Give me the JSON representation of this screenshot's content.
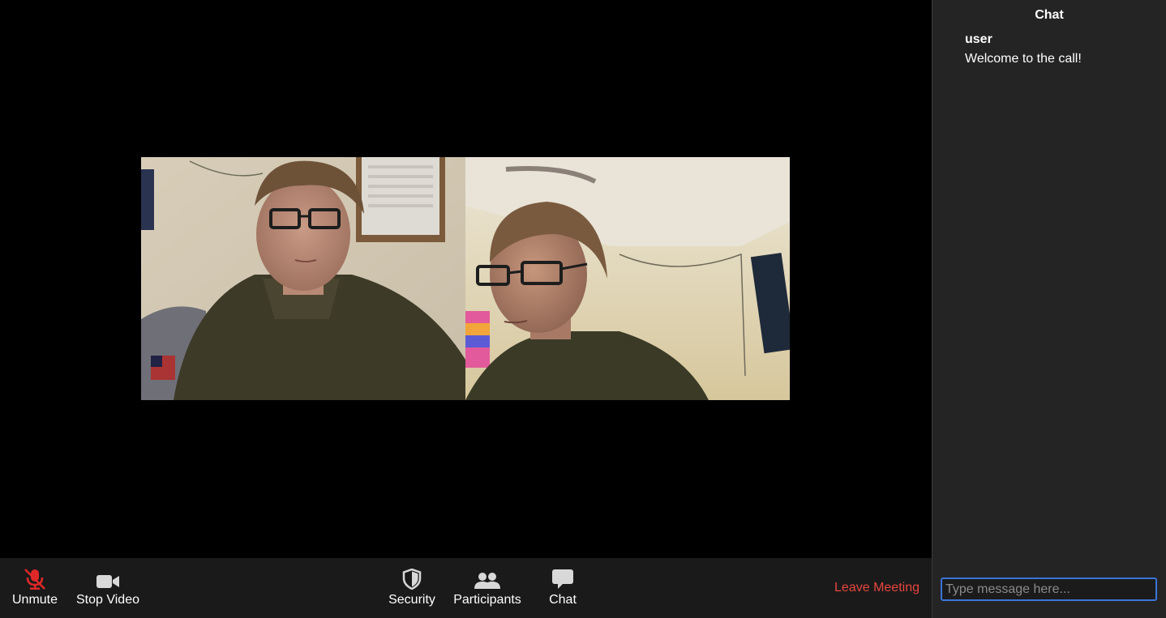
{
  "stage": {
    "tiles": [
      {
        "icon": "participant-video-1"
      },
      {
        "icon": "participant-video-2"
      }
    ]
  },
  "toolbar": {
    "unmute": {
      "label": "Unmute",
      "icon": "muted-mic-icon"
    },
    "stop_video": {
      "label": "Stop Video",
      "icon": "video-camera-icon"
    },
    "security": {
      "label": "Security",
      "icon": "shield-icon"
    },
    "participants": {
      "label": "Participants",
      "icon": "people-icon"
    },
    "chat": {
      "label": "Chat",
      "icon": "speech-bubble-icon"
    },
    "leave": {
      "label": "Leave Meeting"
    }
  },
  "chat": {
    "title": "Chat",
    "messages": [
      {
        "sender": "user",
        "text": "Welcome to the call!"
      }
    ],
    "input": {
      "value": "",
      "placeholder": "Type message here..."
    }
  },
  "colors": {
    "toolbar_bg": "#1a1a1a",
    "chat_bg": "#242424",
    "leave_red": "#e8463f",
    "mute_red": "#e02828",
    "input_focus": "#3a75d8"
  }
}
